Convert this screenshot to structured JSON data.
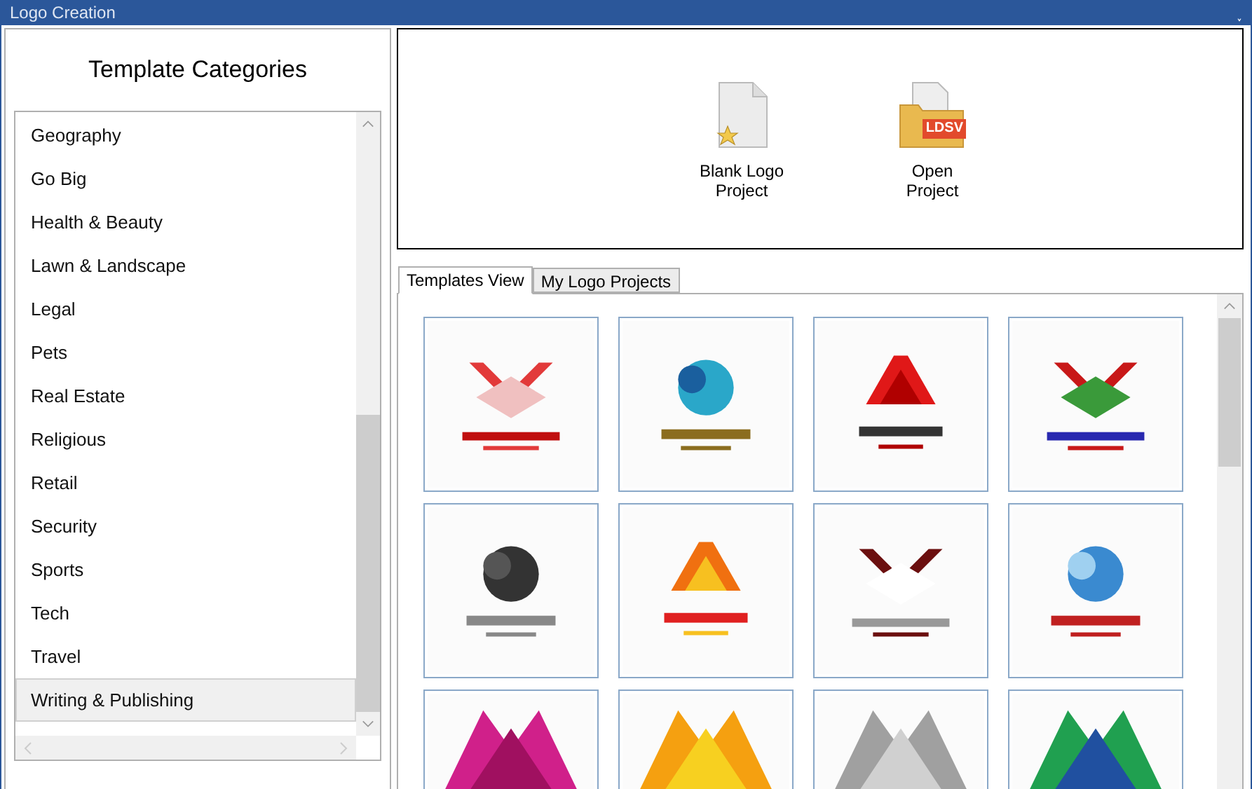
{
  "window": {
    "title": "Logo Creation",
    "collapse_glyph": "˯"
  },
  "sidebar": {
    "title": "Template Categories",
    "items": [
      {
        "label": "Geography",
        "selected": false
      },
      {
        "label": "Go Big",
        "selected": false
      },
      {
        "label": "Health & Beauty",
        "selected": false
      },
      {
        "label": "Lawn & Landscape",
        "selected": false
      },
      {
        "label": "Legal",
        "selected": false
      },
      {
        "label": "Pets",
        "selected": false
      },
      {
        "label": "Real Estate",
        "selected": false
      },
      {
        "label": "Religious",
        "selected": false
      },
      {
        "label": "Retail",
        "selected": false
      },
      {
        "label": "Security",
        "selected": false
      },
      {
        "label": "Sports",
        "selected": false
      },
      {
        "label": "Tech",
        "selected": false
      },
      {
        "label": "Travel",
        "selected": false
      },
      {
        "label": "Writing & Publishing",
        "selected": true
      }
    ]
  },
  "actions": [
    {
      "kind": "blank",
      "label": "Blank Logo Project"
    },
    {
      "kind": "open",
      "label": "Open Project",
      "badge": "LDSV"
    }
  ],
  "tabs": [
    {
      "label": "Templates View",
      "selected": true
    },
    {
      "label": "My Logo Projects",
      "selected": false
    }
  ]
}
